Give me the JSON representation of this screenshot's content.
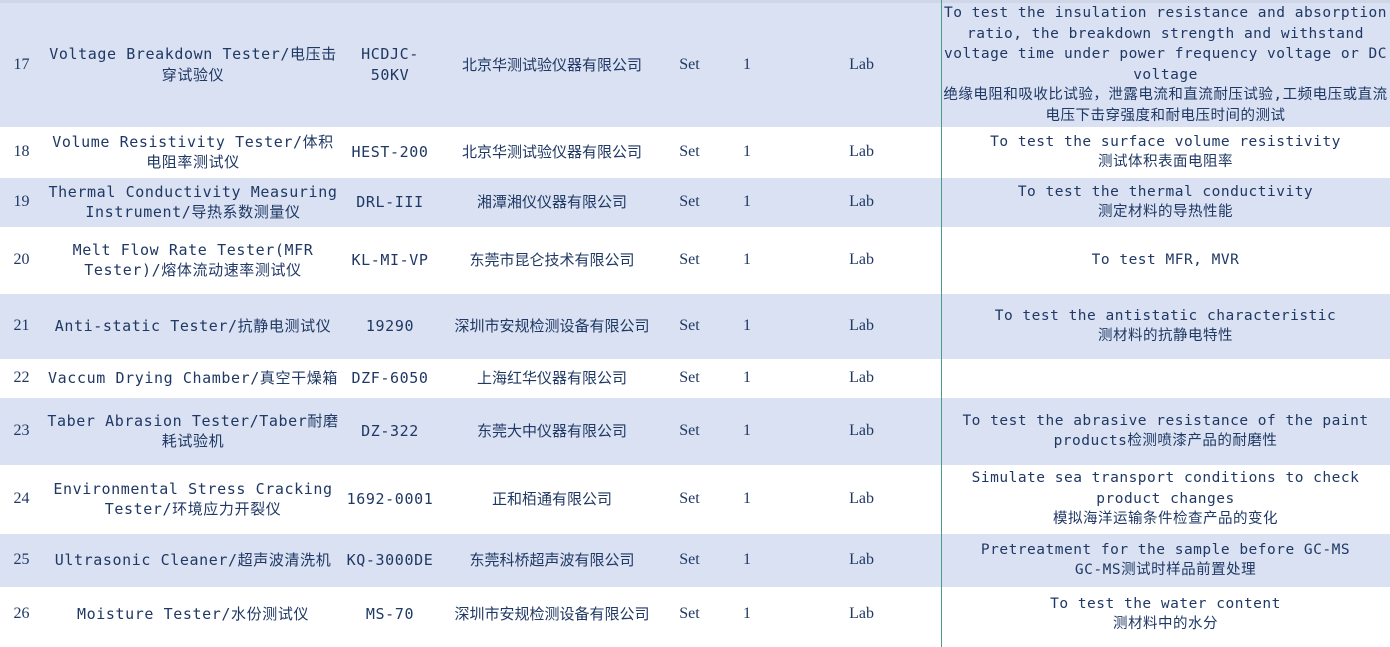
{
  "rows": [
    {
      "no": "17",
      "name": "Voltage Breakdown Tester/电压击穿试验仪",
      "model": "HCDJC-50KV",
      "manufacturer": "北京华测试验仪器有限公司",
      "unit": "Set",
      "qty": "1",
      "location": "Lab",
      "description": "To test the insulation resistance and absorption ratio, the breakdown strength and withstand voltage time under power frequency voltage or DC voltage\n绝缘电阻和吸收比试验，泄露电流和直流耐压试验,工频电压或直流电压下击穿强度和耐电压时间的测试"
    },
    {
      "no": "18",
      "name": "Volume Resistivity Tester/体积电阻率测试仪",
      "model": "HEST-200",
      "manufacturer": "北京华测试验仪器有限公司",
      "unit": "Set",
      "qty": "1",
      "location": "Lab",
      "description": "To test the surface volume resistivity\n测试体积表面电阻率"
    },
    {
      "no": "19",
      "name": "Thermal Conductivity Measuring Instrument/导热系数测量仪",
      "model": "DRL-III",
      "manufacturer": "湘潭湘仪仪器有限公司",
      "unit": "Set",
      "qty": "1",
      "location": "Lab",
      "description": "To test the thermal conductivity\n测定材料的导热性能"
    },
    {
      "no": "20",
      "name": "Melt Flow Rate Tester(MFR Tester)/熔体流动速率测试仪",
      "model": "KL-MI-VP",
      "manufacturer": "东莞市昆仑技术有限公司",
      "unit": "Set",
      "qty": "1",
      "location": "Lab",
      "description": "To test MFR, MVR"
    },
    {
      "no": "21",
      "name": "Anti-static Tester/抗静电测试仪",
      "model": "19290",
      "manufacturer": "深圳市安规检测设备有限公司",
      "unit": "Set",
      "qty": "1",
      "location": "Lab",
      "description": "To test the antistatic characteristic\n测材料的抗静电特性"
    },
    {
      "no": "22",
      "name": "Vaccum Drying Chamber/真空干燥箱",
      "model": "DZF-6050",
      "manufacturer": "上海红华仪器有限公司",
      "unit": "Set",
      "qty": "1",
      "location": "Lab",
      "description": ""
    },
    {
      "no": "23",
      "name": "Taber Abrasion Tester/Taber耐磨耗试验机",
      "model": "DZ-322",
      "manufacturer": "东莞大中仪器有限公司",
      "unit": "Set",
      "qty": "1",
      "location": "Lab",
      "description": "To test the abrasive resistance of the paint products检测喷漆产品的耐磨性"
    },
    {
      "no": "24",
      "name": "Environmental Stress Cracking Tester/环境应力开裂仪",
      "model": "1692-0001",
      "manufacturer": "正和栢通有限公司",
      "unit": "Set",
      "qty": "1",
      "location": "Lab",
      "description": "Simulate sea transport conditions to check product changes\n模拟海洋运输条件检查产品的变化"
    },
    {
      "no": "25",
      "name": "Ultrasonic Cleaner/超声波清洗机",
      "model": "KQ-3000DE",
      "manufacturer": "东莞科桥超声波有限公司",
      "unit": "Set",
      "qty": "1",
      "location": "Lab",
      "description": "Pretreatment for the sample before GC-MS\nGC-MS测试时样品前置处理"
    },
    {
      "no": "26",
      "name": "Moisture Tester/水份测试仪",
      "model": "MS-70",
      "manufacturer": "深圳市安规检测设备有限公司",
      "unit": "Set",
      "qty": "1",
      "location": "Lab",
      "description": "To test the water content\n测材料中的水分"
    }
  ]
}
